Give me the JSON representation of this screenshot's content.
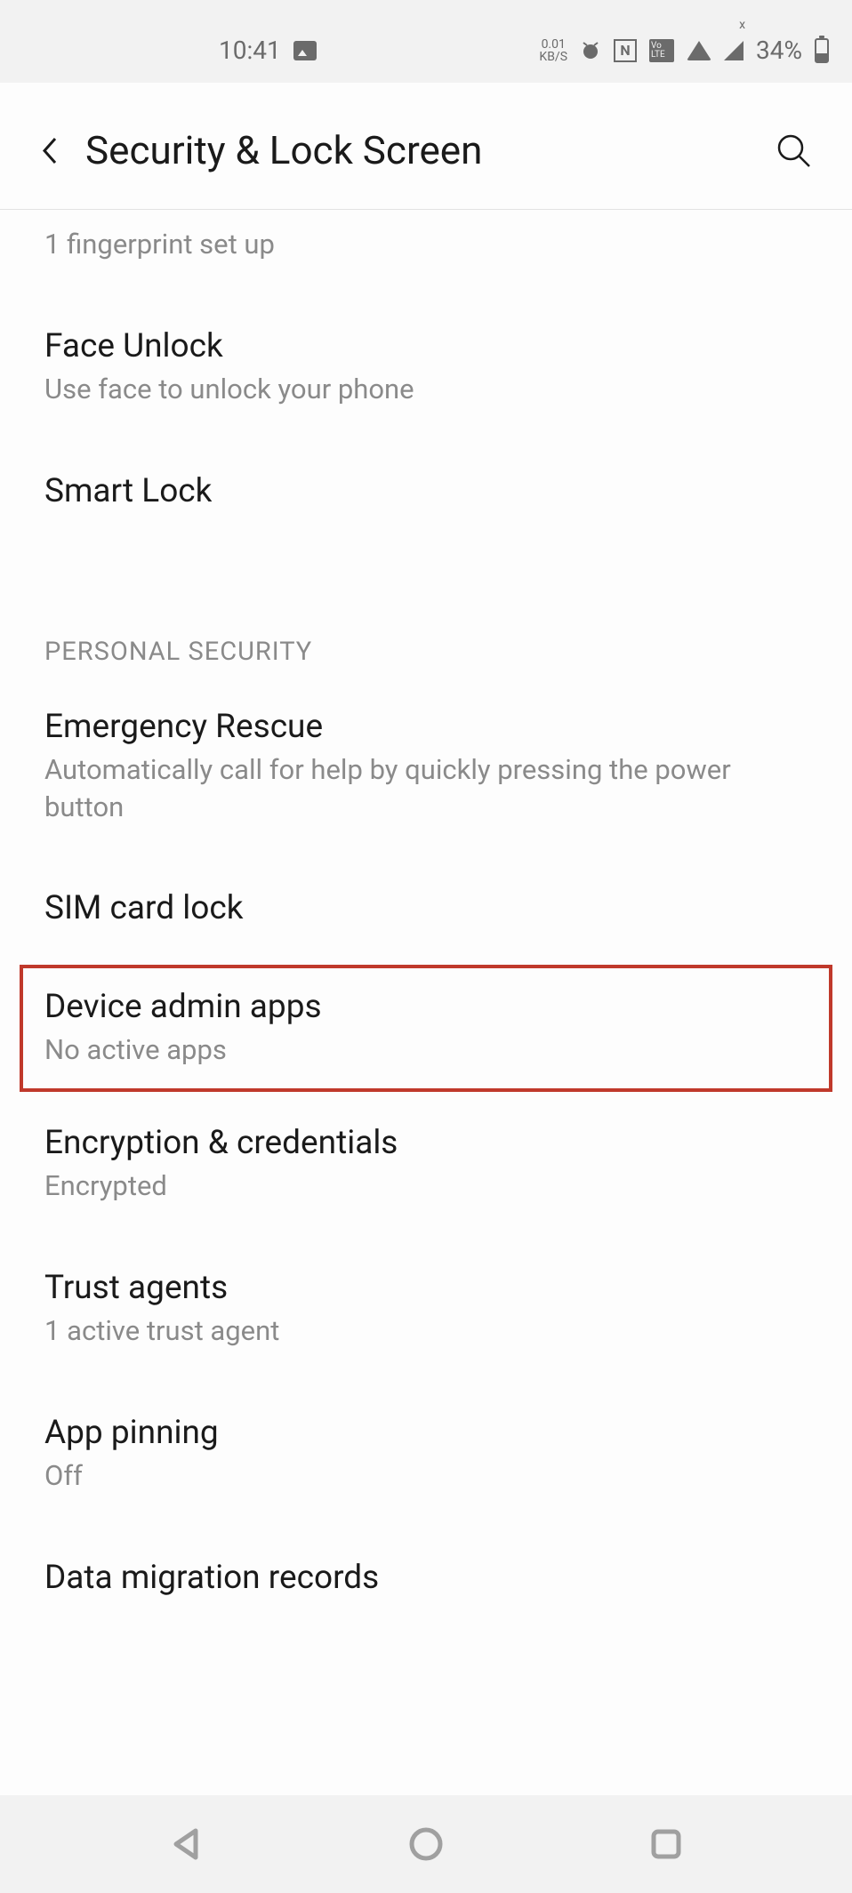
{
  "status": {
    "time": "10:41",
    "network_speed_top": "0.01",
    "network_speed_bottom": "KB/S",
    "battery_percent": "34%",
    "nfc_label": "N",
    "volte_label": "Vo LTE"
  },
  "header": {
    "title": "Security & Lock Screen"
  },
  "items": {
    "fingerprint_sub": "1 fingerprint set up",
    "face_unlock": {
      "title": "Face Unlock",
      "subtitle": "Use face to unlock your phone"
    },
    "smart_lock": {
      "title": "Smart Lock"
    },
    "section_personal": "PERSONAL SECURITY",
    "emergency": {
      "title": "Emergency Rescue",
      "subtitle": "Automatically call for help by quickly pressing the power button"
    },
    "sim_lock": {
      "title": "SIM card lock"
    },
    "device_admin": {
      "title": "Device admin apps",
      "subtitle": "No active apps"
    },
    "encryption": {
      "title": "Encryption & credentials",
      "subtitle": "Encrypted"
    },
    "trust_agents": {
      "title": "Trust agents",
      "subtitle": "1 active trust agent"
    },
    "app_pinning": {
      "title": "App pinning",
      "subtitle": "Off"
    },
    "data_migration": {
      "title": "Data migration records"
    }
  }
}
